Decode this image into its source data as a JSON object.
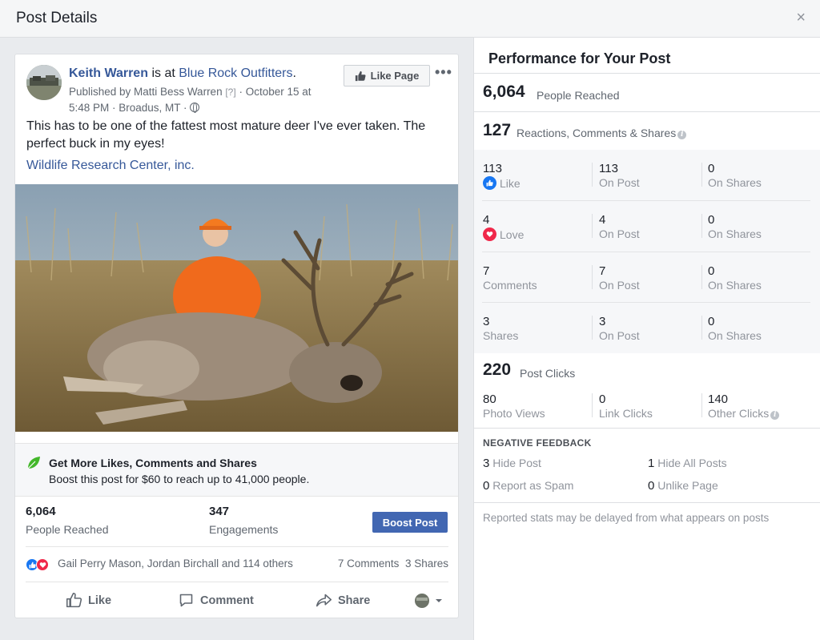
{
  "modal": {
    "title": "Post Details",
    "close": "×"
  },
  "post": {
    "author": "Keith Warren",
    "is_at": "is at",
    "location_page": "Blue Rock Outfitters",
    "period": ".",
    "published_by": "Published by Matti Bess Warren",
    "help_marker": "[?]",
    "date": "· October 15 at",
    "time_place": "5:48 PM · Broadus, MT ·",
    "like_page_label": "Like Page",
    "more": "•••",
    "text": "This has to be one of the fattest most mature deer I've ever taken. The perfect buck in my eyes!",
    "link": "Wildlife Research Center, inc."
  },
  "promo": {
    "title": "Get More Likes, Comments and Shares",
    "desc": "Boost this post for $60 to reach up to 41,000 people."
  },
  "post_stats": {
    "reached_value": "6,064",
    "reached_label": "People Reached",
    "engagements_value": "347",
    "engagements_label": "Engagements",
    "boost_label": "Boost Post"
  },
  "reactions": {
    "names": "Gail Perry Mason, Jordan Birchall and 114 others",
    "comments": "7 Comments",
    "shares": "3 Shares"
  },
  "actions": {
    "like": "Like",
    "comment": "Comment",
    "share": "Share"
  },
  "performance": {
    "title": "Performance for Your Post",
    "reached_value": "6,064",
    "reached_label": "People Reached",
    "rcs_value": "127",
    "rcs_label": "Reactions, Comments & Shares",
    "rows": [
      {
        "v1": "113",
        "l1": "Like",
        "v2": "113",
        "l2": "On Post",
        "v3": "0",
        "l3": "On Shares"
      },
      {
        "v1": "4",
        "l1": "Love",
        "v2": "4",
        "l2": "On Post",
        "v3": "0",
        "l3": "On Shares"
      },
      {
        "v1": "7",
        "l1": "Comments",
        "v2": "7",
        "l2": "On Post",
        "v3": "0",
        "l3": "On Shares"
      },
      {
        "v1": "3",
        "l1": "Shares",
        "v2": "3",
        "l2": "On Post",
        "v3": "0",
        "l3": "On Shares"
      }
    ],
    "clicks_value": "220",
    "clicks_label": "Post Clicks",
    "clicks": [
      {
        "v": "80",
        "l": "Photo Views"
      },
      {
        "v": "0",
        "l": "Link Clicks"
      },
      {
        "v": "140",
        "l": "Other Clicks"
      }
    ],
    "negative_title": "NEGATIVE FEEDBACK",
    "negative": [
      {
        "v": "3",
        "l": "Hide Post"
      },
      {
        "v": "1",
        "l": "Hide All Posts"
      },
      {
        "v": "0",
        "l": "Report as Spam"
      },
      {
        "v": "0",
        "l": "Unlike Page"
      }
    ],
    "footnote": "Reported stats may be delayed from what appears on posts"
  },
  "colors": {
    "brand_blue": "#4267b2",
    "link_blue": "#365899",
    "like_blue": "#1877f2",
    "love_red": "#f0284a"
  }
}
